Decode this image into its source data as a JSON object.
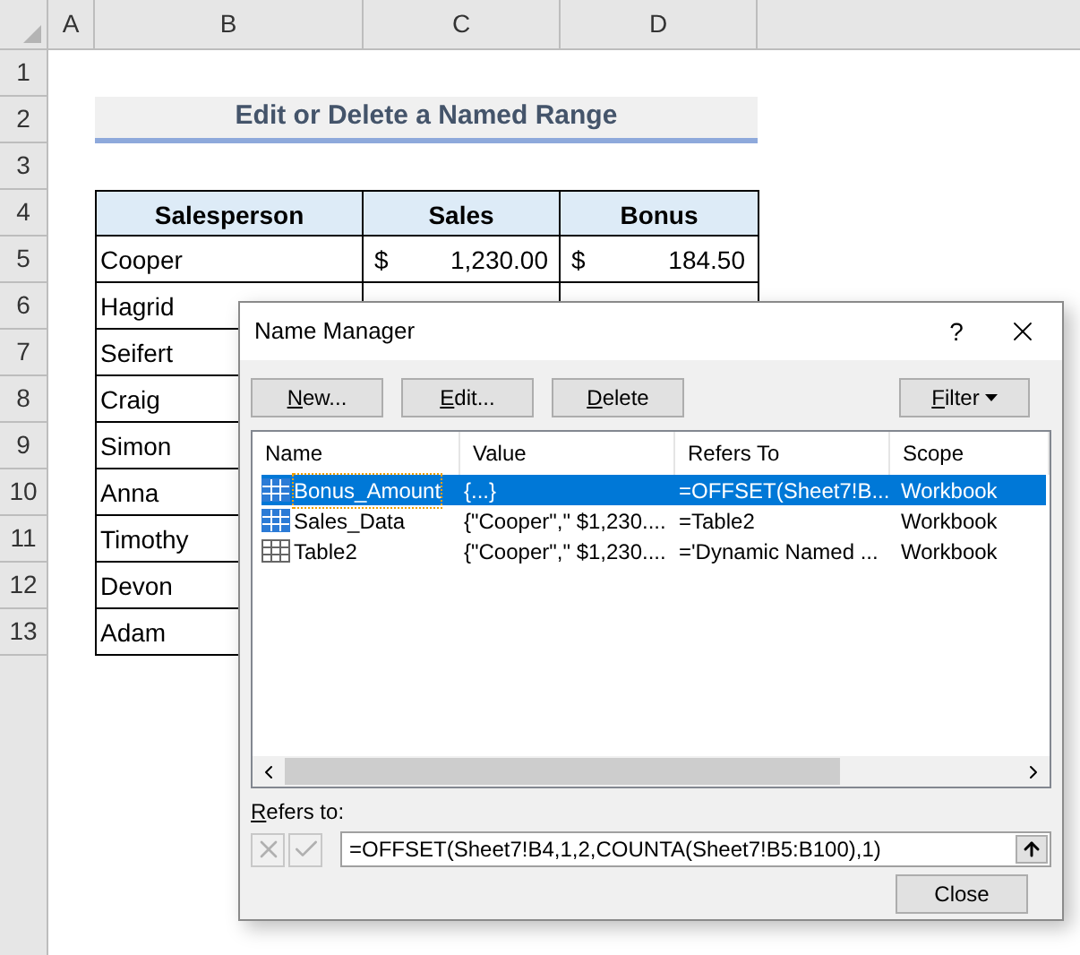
{
  "sheet": {
    "columns": [
      "A",
      "B",
      "C",
      "D"
    ],
    "rows": [
      "1",
      "2",
      "3",
      "4",
      "5",
      "6",
      "7",
      "8",
      "9",
      "10",
      "11",
      "12",
      "13"
    ],
    "title": "Edit or Delete a Named Range",
    "headers": [
      "Salesperson",
      "Sales",
      "Bonus"
    ],
    "data": [
      {
        "name": "Cooper",
        "sales_symbol": "$",
        "sales": "1,230.00",
        "bonus_symbol": "$",
        "bonus": "184.50"
      },
      {
        "name": "Hagrid"
      },
      {
        "name": "Seifert"
      },
      {
        "name": "Craig"
      },
      {
        "name": "Simon"
      },
      {
        "name": "Anna"
      },
      {
        "name": "Timothy"
      },
      {
        "name": "Devon"
      },
      {
        "name": "Adam"
      }
    ]
  },
  "dialog": {
    "title": "Name Manager",
    "help": "?",
    "buttons": [
      {
        "key": "N",
        "rest": "ew..."
      },
      {
        "key": "E",
        "rest": "dit..."
      },
      {
        "key": "D",
        "rest": "elete"
      }
    ],
    "filter": {
      "key": "F",
      "rest": "ilter"
    },
    "columns": [
      "Name",
      "Value",
      "Refers To",
      "Scope"
    ],
    "names": [
      {
        "kind": "range",
        "name": "Bonus_Amount",
        "value": "{...}",
        "refers_to": "=OFFSET(Sheet7!B...",
        "scope": "Workbook",
        "selected": true
      },
      {
        "kind": "range",
        "name": "Sales_Data",
        "value": "{\"Cooper\",\" $1,230....",
        "refers_to": "=Table2",
        "scope": "Workbook",
        "selected": false
      },
      {
        "kind": "table",
        "name": "Table2",
        "value": "{\"Cooper\",\" $1,230....",
        "refers_to": "='Dynamic Named ...",
        "scope": "Workbook",
        "selected": false
      }
    ],
    "refers_label": {
      "key": "R",
      "rest": "efers to:"
    },
    "refers_value": "=OFFSET(Sheet7!B4,1,2,COUNTA(Sheet7!B5:B100),1)",
    "close": "Close"
  }
}
